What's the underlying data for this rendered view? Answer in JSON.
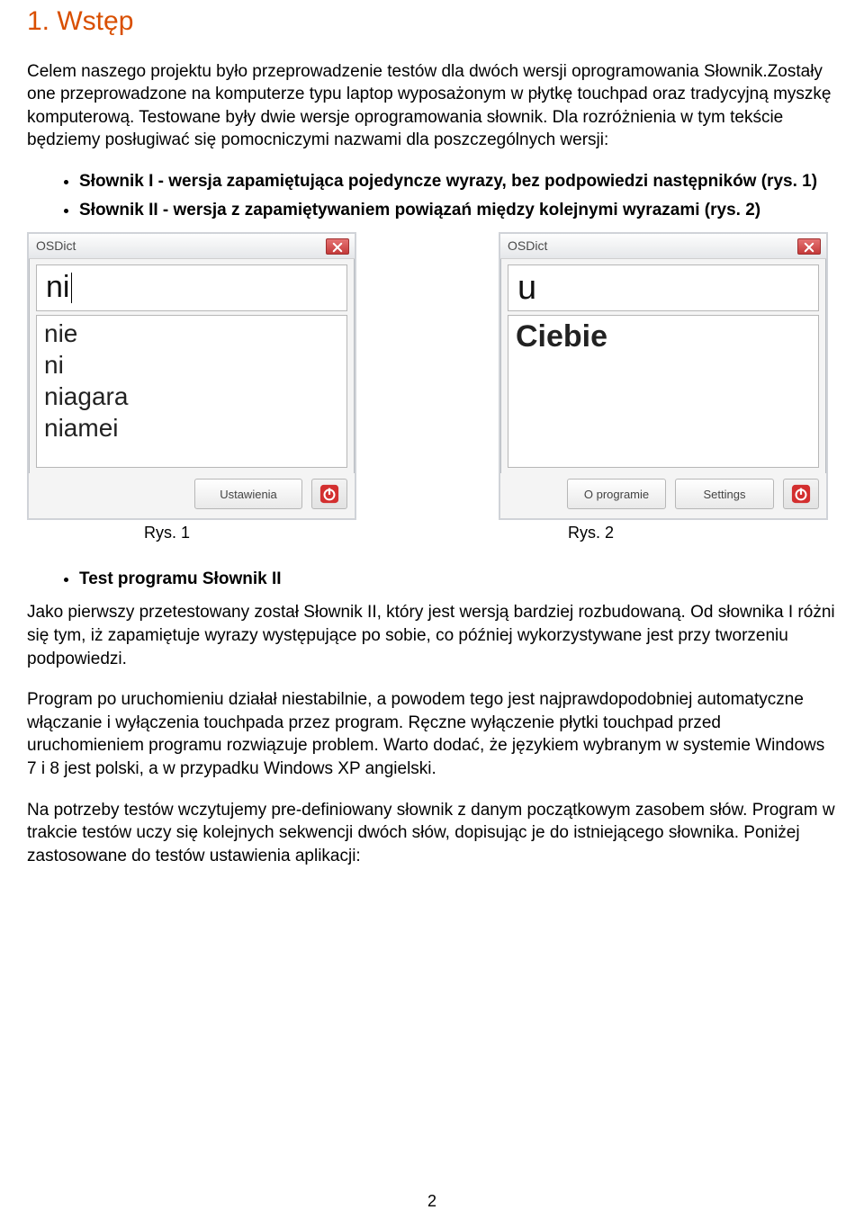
{
  "heading": "1. Wstęp",
  "p1": "Celem naszego projektu było przeprowadzenie testów dla dwóch wersji oprogramowania Słownik.Zostały one przeprowadzone na komputerze typu laptop wyposażonym w płytkę touchpad oraz tradycyjną myszkę komputerową. Testowane były dwie wersje oprogramowania słownik. Dla rozróżnienia w tym tekście będziemy posługiwać się pomocniczymi nazwami dla poszczególnych wersji:",
  "bullets_a": [
    "Słownik I - wersja zapamiętująca pojedyncze wyrazy, bez podpowiedzi następników (rys. 1)",
    "Słownik II - wersja z zapamiętywaniem powiązań między kolejnymi wyrazami (rys. 2)"
  ],
  "fig1": {
    "title": "OSDict",
    "input": "ni",
    "suggestions": [
      "nie",
      "ni",
      "niagara",
      "niamei"
    ],
    "button_settings": "Ustawienia",
    "caption": "Rys. 1"
  },
  "fig2": {
    "title": "OSDict",
    "input": "u",
    "suggestions": [
      "Ciebie"
    ],
    "button_about": "O programie",
    "button_settings": "Settings",
    "caption": "Rys. 2"
  },
  "bullets_b": [
    "Test programu Słownik II"
  ],
  "p2": "Jako pierwszy przetestowany został Słownik II, który jest wersją bardziej rozbudowaną. Od słownika I różni się tym, iż zapamiętuje wyrazy występujące po sobie, co później wykorzystywane jest przy tworzeniu podpowiedzi.",
  "p3": "Program po uruchomieniu działał niestabilnie, a powodem tego jest najprawdopodobniej automatyczne włączanie i wyłączenia touchpada przez program. Ręczne wyłączenie płytki touchpad przed uruchomieniem programu rozwiązuje problem. Warto dodać, że językiem wybranym w systemie Windows 7 i 8 jest polski, a w przypadku Windows XP angielski.",
  "p4": "Na potrzeby testów wczytujemy pre-definiowany słownik z danym początkowym zasobem słów. Program w trakcie testów uczy się kolejnych sekwencji dwóch słów, dopisując je do istniejącego słownika. Poniżej zastosowane do testów ustawienia aplikacji:",
  "page_number": "2"
}
